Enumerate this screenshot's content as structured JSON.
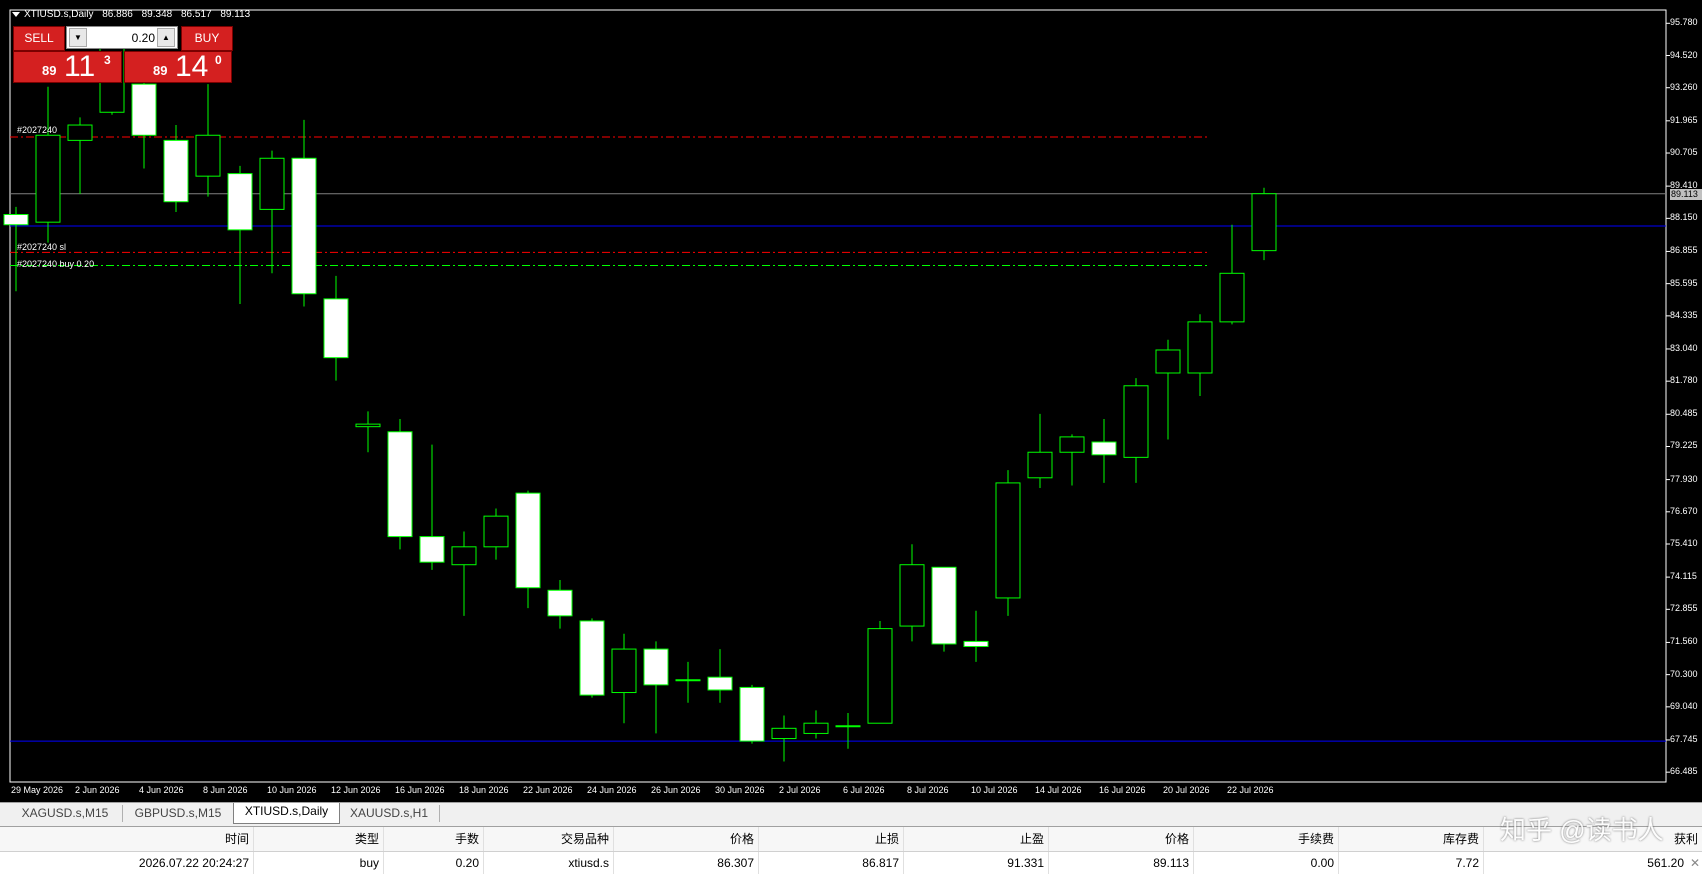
{
  "window": {
    "symbol_title": "XTIUSD.s,Daily",
    "ohlc": [
      "86.886",
      "89.348",
      "86.517",
      "89.113"
    ]
  },
  "trade_panel": {
    "sell_label": "SELL",
    "buy_label": "BUY",
    "lot_value": "0.20",
    "sell_price": {
      "prefix": "89",
      "big": "11",
      "sup": "3"
    },
    "buy_price": {
      "prefix": "89",
      "big": "14",
      "sup": "0"
    }
  },
  "order_labels": {
    "tp": "#2027240",
    "sl": "#2027240 sl",
    "open": "#2027240 buy 0.20"
  },
  "price_axis": [
    "95.780",
    "94.520",
    "93.260",
    "91.965",
    "90.705",
    "89.410",
    "88.150",
    "86.855",
    "85.595",
    "84.335",
    "83.040",
    "81.780",
    "80.485",
    "79.225",
    "77.930",
    "76.670",
    "75.410",
    "74.115",
    "72.855",
    "71.560",
    "70.300",
    "69.040",
    "67.745",
    "66.485"
  ],
  "price_tags": {
    "current": "89.113"
  },
  "date_axis": [
    "29 May 2026",
    "2 Jun 2026",
    "4 Jun 2026",
    "8 Jun 2026",
    "10 Jun 2026",
    "12 Jun 2026",
    "16 Jun 2026",
    "18 Jun 2026",
    "22 Jun 2026",
    "24 Jun 2026",
    "26 Jun 2026",
    "30 Jun 2026",
    "2 Jul 2026",
    "6 Jul 2026",
    "8 Jul 2026",
    "10 Jul 2026",
    "14 Jul 2026",
    "16 Jul 2026",
    "20 Jul 2026",
    "22 Jul 2026"
  ],
  "colors": {
    "background": "#000000",
    "candle_outline": "#00ff00",
    "bull_body": "#000000",
    "bear_body": "#ffffff",
    "tp_line": "#ff0000",
    "sl_line": "#ff0000",
    "open_line": "#00ff00",
    "bid_line": "#808080",
    "blue_line": "#0000ff",
    "panel_red": "#d42020"
  },
  "candles": [
    {
      "date": "29 May 2026",
      "o": 88.3,
      "h": 88.6,
      "l": 85.3,
      "c": 87.9
    },
    {
      "date": "1 Jun 2026",
      "o": 88.0,
      "h": 93.3,
      "l": 87.2,
      "c": 91.4
    },
    {
      "date": "2 Jun 2026",
      "o": 91.2,
      "h": 92.1,
      "l": 89.1,
      "c": 91.8
    },
    {
      "date": "3 Jun 2026",
      "o": 92.3,
      "h": 95.3,
      "l": 92.2,
      "c": 95.0
    },
    {
      "date": "4 Jun 2026",
      "o": 93.4,
      "h": 94.5,
      "l": 90.1,
      "c": 91.4
    },
    {
      "date": "5 Jun 2026",
      "o": 91.2,
      "h": 91.8,
      "l": 88.4,
      "c": 88.8
    },
    {
      "date": "8 Jun 2026",
      "o": 89.8,
      "h": 93.4,
      "l": 89.0,
      "c": 91.4
    },
    {
      "date": "9 Jun 2026",
      "o": 89.9,
      "h": 90.2,
      "l": 84.8,
      "c": 87.7
    },
    {
      "date": "10 Jun 2026",
      "o": 88.5,
      "h": 90.8,
      "l": 86.0,
      "c": 90.5
    },
    {
      "date": "11 Jun 2026",
      "o": 90.5,
      "h": 92.0,
      "l": 84.7,
      "c": 85.2
    },
    {
      "date": "12 Jun 2026",
      "o": 85.0,
      "h": 85.9,
      "l": 81.8,
      "c": 82.7
    },
    {
      "date": "15 Jun 2026",
      "o": 80.0,
      "h": 80.6,
      "l": 79.0,
      "c": 80.1
    },
    {
      "date": "16 Jun 2026",
      "o": 79.8,
      "h": 80.3,
      "l": 75.2,
      "c": 75.7
    },
    {
      "date": "17 Jun 2026",
      "o": 75.7,
      "h": 79.3,
      "l": 74.4,
      "c": 74.7
    },
    {
      "date": "18 Jun 2026",
      "o": 74.6,
      "h": 75.9,
      "l": 72.6,
      "c": 75.3
    },
    {
      "date": "19 Jun 2026",
      "o": 75.3,
      "h": 76.8,
      "l": 74.8,
      "c": 76.5
    },
    {
      "date": "22 Jun 2026",
      "o": 77.4,
      "h": 77.5,
      "l": 72.9,
      "c": 73.7
    },
    {
      "date": "23 Jun 2026",
      "o": 73.6,
      "h": 74.0,
      "l": 72.1,
      "c": 72.6
    },
    {
      "date": "24 Jun 2026",
      "o": 72.4,
      "h": 72.5,
      "l": 69.4,
      "c": 69.5
    },
    {
      "date": "25 Jun 2026",
      "o": 69.6,
      "h": 71.9,
      "l": 68.4,
      "c": 71.3
    },
    {
      "date": "26 Jun 2026",
      "o": 71.3,
      "h": 71.6,
      "l": 68.0,
      "c": 69.9
    },
    {
      "date": "29 Jun 2026",
      "o": 70.1,
      "h": 70.8,
      "l": 69.2,
      "c": 70.1
    },
    {
      "date": "30 Jun 2026",
      "o": 70.2,
      "h": 71.3,
      "l": 69.2,
      "c": 69.7
    },
    {
      "date": "1 Jul 2026",
      "o": 69.8,
      "h": 69.9,
      "l": 67.6,
      "c": 67.7
    },
    {
      "date": "2 Jul 2026",
      "o": 67.8,
      "h": 68.7,
      "l": 66.9,
      "c": 68.2
    },
    {
      "date": "3 Jul 2026",
      "o": 68.0,
      "h": 68.9,
      "l": 67.8,
      "c": 68.4
    },
    {
      "date": "6 Jul 2026",
      "o": 68.3,
      "h": 68.8,
      "l": 67.4,
      "c": 68.3
    },
    {
      "date": "7 Jul 2026",
      "o": 68.4,
      "h": 72.4,
      "l": 68.4,
      "c": 72.1
    },
    {
      "date": "8 Jul 2026",
      "o": 72.2,
      "h": 75.4,
      "l": 71.6,
      "c": 74.6
    },
    {
      "date": "9 Jul 2026",
      "o": 74.5,
      "h": 74.5,
      "l": 71.2,
      "c": 71.5
    },
    {
      "date": "10 Jul 2026",
      "o": 71.6,
      "h": 72.8,
      "l": 70.8,
      "c": 71.4
    },
    {
      "date": "13 Jul 2026",
      "o": 73.3,
      "h": 78.3,
      "l": 72.6,
      "c": 77.8
    },
    {
      "date": "14 Jul 2026",
      "o": 78.0,
      "h": 80.5,
      "l": 77.6,
      "c": 79.0
    },
    {
      "date": "15 Jul 2026",
      "o": 79.0,
      "h": 79.7,
      "l": 77.7,
      "c": 79.6
    },
    {
      "date": "16 Jul 2026",
      "o": 79.4,
      "h": 80.3,
      "l": 77.8,
      "c": 78.9
    },
    {
      "date": "17 Jul 2026",
      "o": 78.8,
      "h": 81.9,
      "l": 77.8,
      "c": 81.6
    },
    {
      "date": "20 Jul 2026",
      "o": 82.1,
      "h": 83.4,
      "l": 79.5,
      "c": 83.0
    },
    {
      "date": "21 Jul 2026",
      "o": 82.1,
      "h": 84.4,
      "l": 81.2,
      "c": 84.1
    },
    {
      "date": "22 Jul 2026",
      "o": 84.1,
      "h": 87.9,
      "l": 84.0,
      "c": 86.0
    },
    {
      "date": "23 Jul 2026",
      "o": 86.886,
      "h": 89.348,
      "l": 86.517,
      "c": 89.113
    }
  ],
  "levels": {
    "tp": 91.331,
    "sl": 86.817,
    "open": 86.307,
    "bid": 89.113,
    "blue_upper": 87.85,
    "blue_lower": 67.7
  },
  "tabs": [
    {
      "label": "XAGUSD.s,M15"
    },
    {
      "label": "GBPUSD.s,M15"
    },
    {
      "label": "XTIUSD.s,Daily",
      "active": true
    },
    {
      "label": "XAUUSD.s,H1"
    }
  ],
  "terminal": {
    "headers": [
      "时间",
      "类型",
      "手数",
      "交易品种",
      "价格",
      "止损",
      "止盈",
      "价格",
      "手续费",
      "库存费",
      "获利"
    ],
    "row": [
      "2026.07.22 20:24:27",
      "buy",
      "0.20",
      "xtiusd.s",
      "86.307",
      "86.817",
      "91.331",
      "89.113",
      "0.00",
      "7.72",
      "561.20"
    ],
    "close_glyph": "✕"
  },
  "watermark": "知乎 @读书人"
}
